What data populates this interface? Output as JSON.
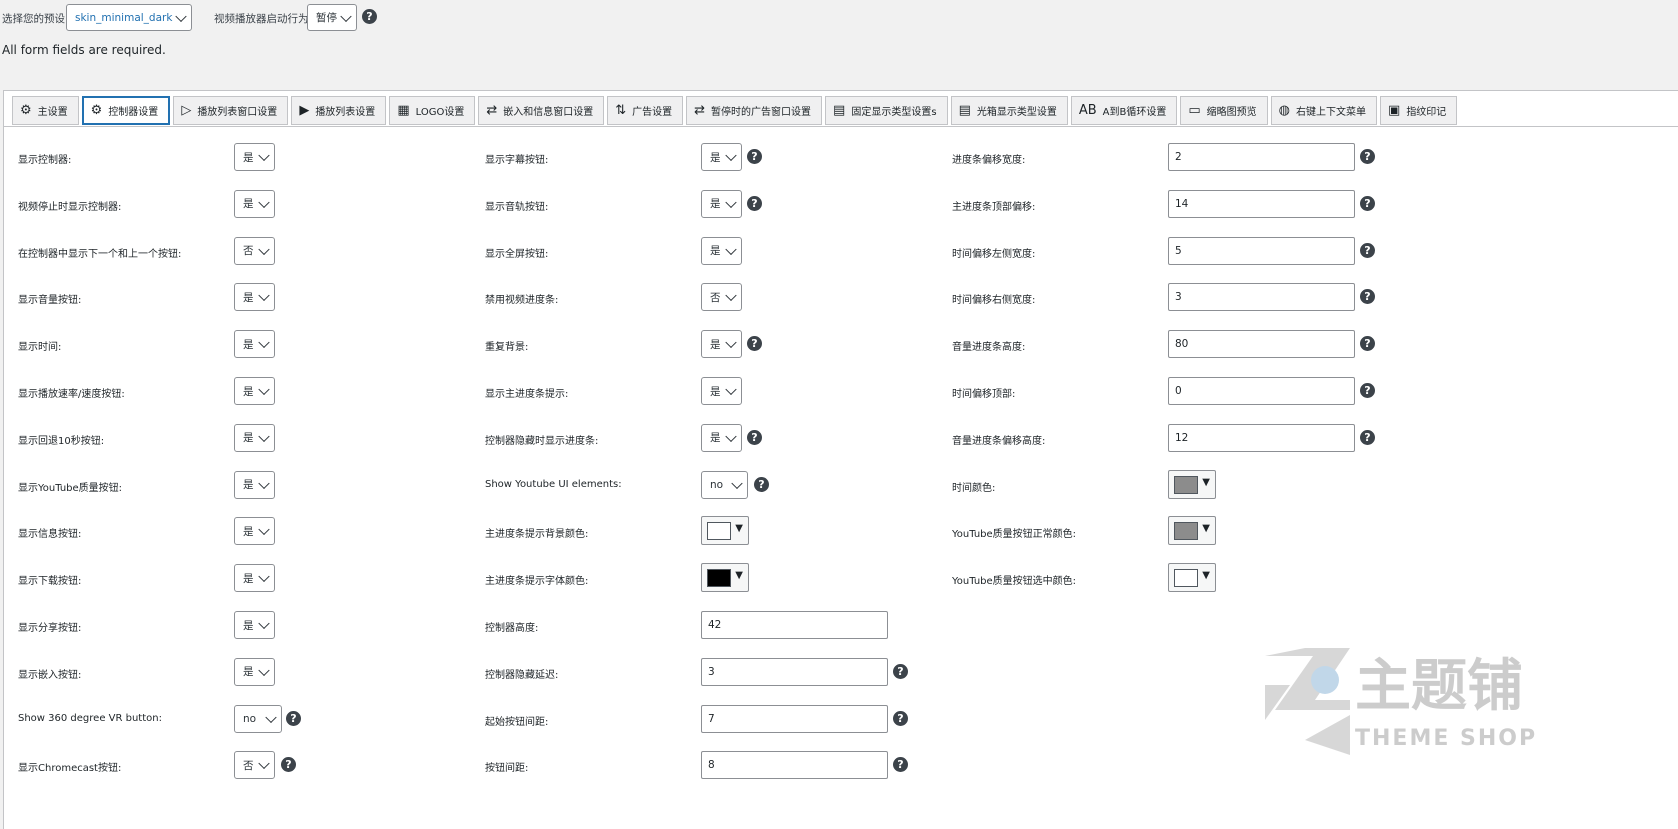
{
  "top": {
    "preset_label": "选择您的预设:",
    "preset_value": "skin_minimal_dark",
    "autoplay_label": "视频播放器启动行为:",
    "autoplay_value": "暂停",
    "required_note": "All form fields are required."
  },
  "tabs": [
    {
      "label": "主设置",
      "icon": "sliders-icon"
    },
    {
      "label": "控制器设置",
      "icon": "gear-icon"
    },
    {
      "label": "播放列表窗口设置",
      "icon": "playlist-window-icon"
    },
    {
      "label": "播放列表设置",
      "icon": "playlist-icon"
    },
    {
      "label": "LOGO设置",
      "icon": "logo-icon"
    },
    {
      "label": "嵌入和信息窗口设置",
      "icon": "embed-icon"
    },
    {
      "label": "广告设置",
      "icon": "ads-icon"
    },
    {
      "label": "暂停时的广告窗口设置",
      "icon": "pause-ads-icon"
    },
    {
      "label": "固定显示类型设置s",
      "icon": "fixed-display-icon"
    },
    {
      "label": "光箱显示类型设置",
      "icon": "lightbox-icon"
    },
    {
      "label": "A到B循环设置",
      "icon": "ab-loop-icon"
    },
    {
      "label": "缩略图预览",
      "icon": "monitor-icon"
    },
    {
      "label": "右键上下文菜单",
      "icon": "mouse-icon"
    },
    {
      "label": "指纹印记",
      "icon": "fingerprint-icon"
    }
  ],
  "col1": [
    {
      "label": "显示控制器:",
      "value": "是"
    },
    {
      "label": "视频停止时显示控制器:",
      "value": "是"
    },
    {
      "label": "在控制器中显示下一个和上一个按钮:",
      "value": "否"
    },
    {
      "label": "显示音量按钮:",
      "value": "是"
    },
    {
      "label": "显示时间:",
      "value": "是"
    },
    {
      "label": "显示播放速率/速度按钮:",
      "value": "是"
    },
    {
      "label": "显示回退10秒按钮:",
      "value": "是"
    },
    {
      "label": "显示YouTube质量按钮:",
      "value": "是"
    },
    {
      "label": "显示信息按钮:",
      "value": "是"
    },
    {
      "label": "显示下载按钮:",
      "value": "是"
    },
    {
      "label": "显示分享按钮:",
      "value": "是"
    },
    {
      "label": "显示嵌入按钮:",
      "value": "是"
    },
    {
      "label": "Show 360 degree VR button:",
      "value": "no"
    },
    {
      "label": "显示Chromecast按钮:",
      "value": "否"
    }
  ],
  "col2": [
    {
      "label": "显示字幕按钮:",
      "value": "是"
    },
    {
      "label": "显示音轨按钮:",
      "value": "是"
    },
    {
      "label": "显示全屏按钮:",
      "value": "是"
    },
    {
      "label": "禁用视频进度条:",
      "value": "否"
    },
    {
      "label": "重复背景:",
      "value": "是"
    },
    {
      "label": "显示主进度条提示:",
      "value": "是"
    },
    {
      "label": "控制器隐藏时显示进度条:",
      "value": "是"
    },
    {
      "label": "Show Youtube UI elements:",
      "value": "no"
    },
    {
      "label": "主进度条提示背景颜色:",
      "value": "#ffffff"
    },
    {
      "label": "主进度条提示字体颜色:",
      "value": "#000000"
    },
    {
      "label": "控制器高度:",
      "value": "42"
    },
    {
      "label": "控制器隐藏延迟:",
      "value": "3"
    },
    {
      "label": "起始按钮间距:",
      "value": "7"
    },
    {
      "label": "按钮间距:",
      "value": "8"
    }
  ],
  "col3": [
    {
      "label": "进度条偏移宽度:",
      "value": "2"
    },
    {
      "label": "主进度条顶部偏移:",
      "value": "14"
    },
    {
      "label": "时间偏移左侧宽度:",
      "value": "5"
    },
    {
      "label": "时间偏移右侧宽度:",
      "value": "3"
    },
    {
      "label": "音量进度条高度:",
      "value": "80"
    },
    {
      "label": "时间偏移顶部:",
      "value": "0"
    },
    {
      "label": "音量进度条偏移高度:",
      "value": "12"
    },
    {
      "label": "时间颜色:",
      "value": "#8c8c8c"
    },
    {
      "label": "YouTube质量按钮正常颜色:",
      "value": "#8c8c8c"
    },
    {
      "label": "YouTube质量按钮选中颜色:",
      "value": "#ffffff"
    }
  ],
  "watermark": {
    "brand": "主题铺",
    "sub": "THEME SHOP"
  }
}
